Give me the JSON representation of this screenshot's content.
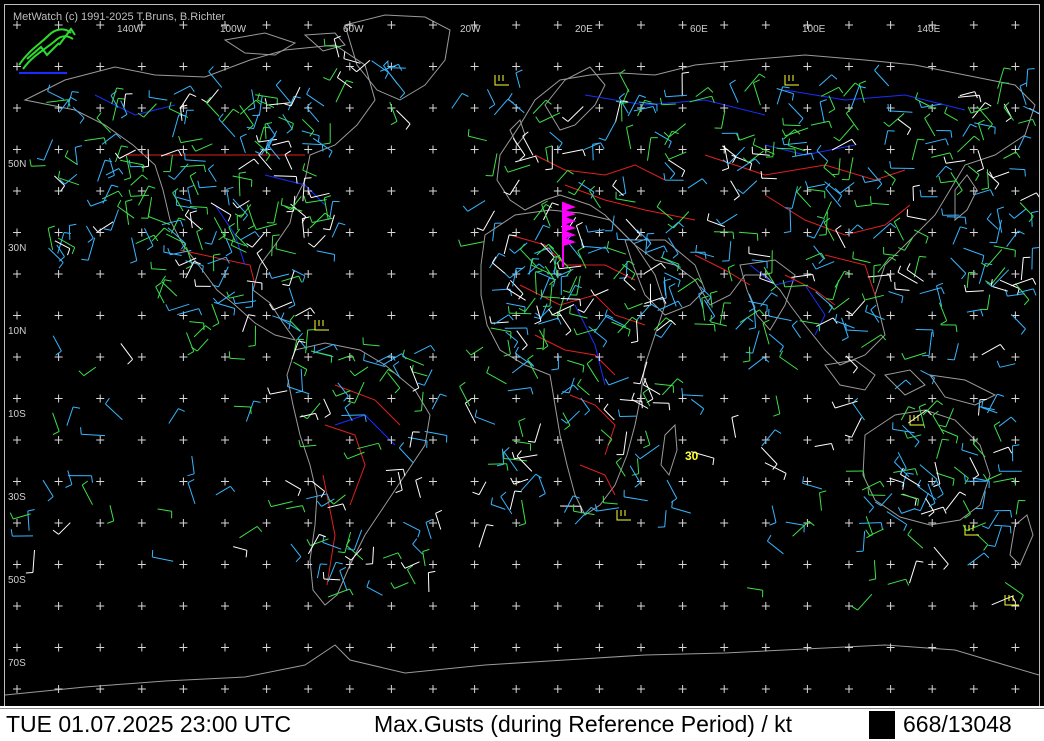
{
  "copyright": "MetWatch  (c) 1991-2025 T.Bruns, B.Richter",
  "lon_labels": [
    "140W",
    "100W",
    "60W",
    "20W",
    "20E",
    "60E",
    "100E",
    "140E"
  ],
  "lat_labels": [
    "50N",
    "30N",
    "10N",
    "10S",
    "30S",
    "50S",
    "70S"
  ],
  "status": {
    "datetime": "TUE 01.07.2025 23:00 UTC",
    "title": "Max.Gusts (during Reference Period) / kt",
    "count": "668/13048"
  },
  "highlight_value": "30",
  "colors": {
    "background": "#000000",
    "coastline": "#9a9a9a",
    "borders": "#e02020",
    "rivers": "#1a2dff",
    "grid_cross": "#d8d8d8",
    "wind_white": "#ffffff",
    "wind_cyan": "#38b6ff",
    "wind_green": "#3ee04a",
    "wind_yellow": "#ffff33",
    "wind_magenta": "#ff00ff"
  },
  "icons": [
    "metwatch-logo-icon"
  ]
}
